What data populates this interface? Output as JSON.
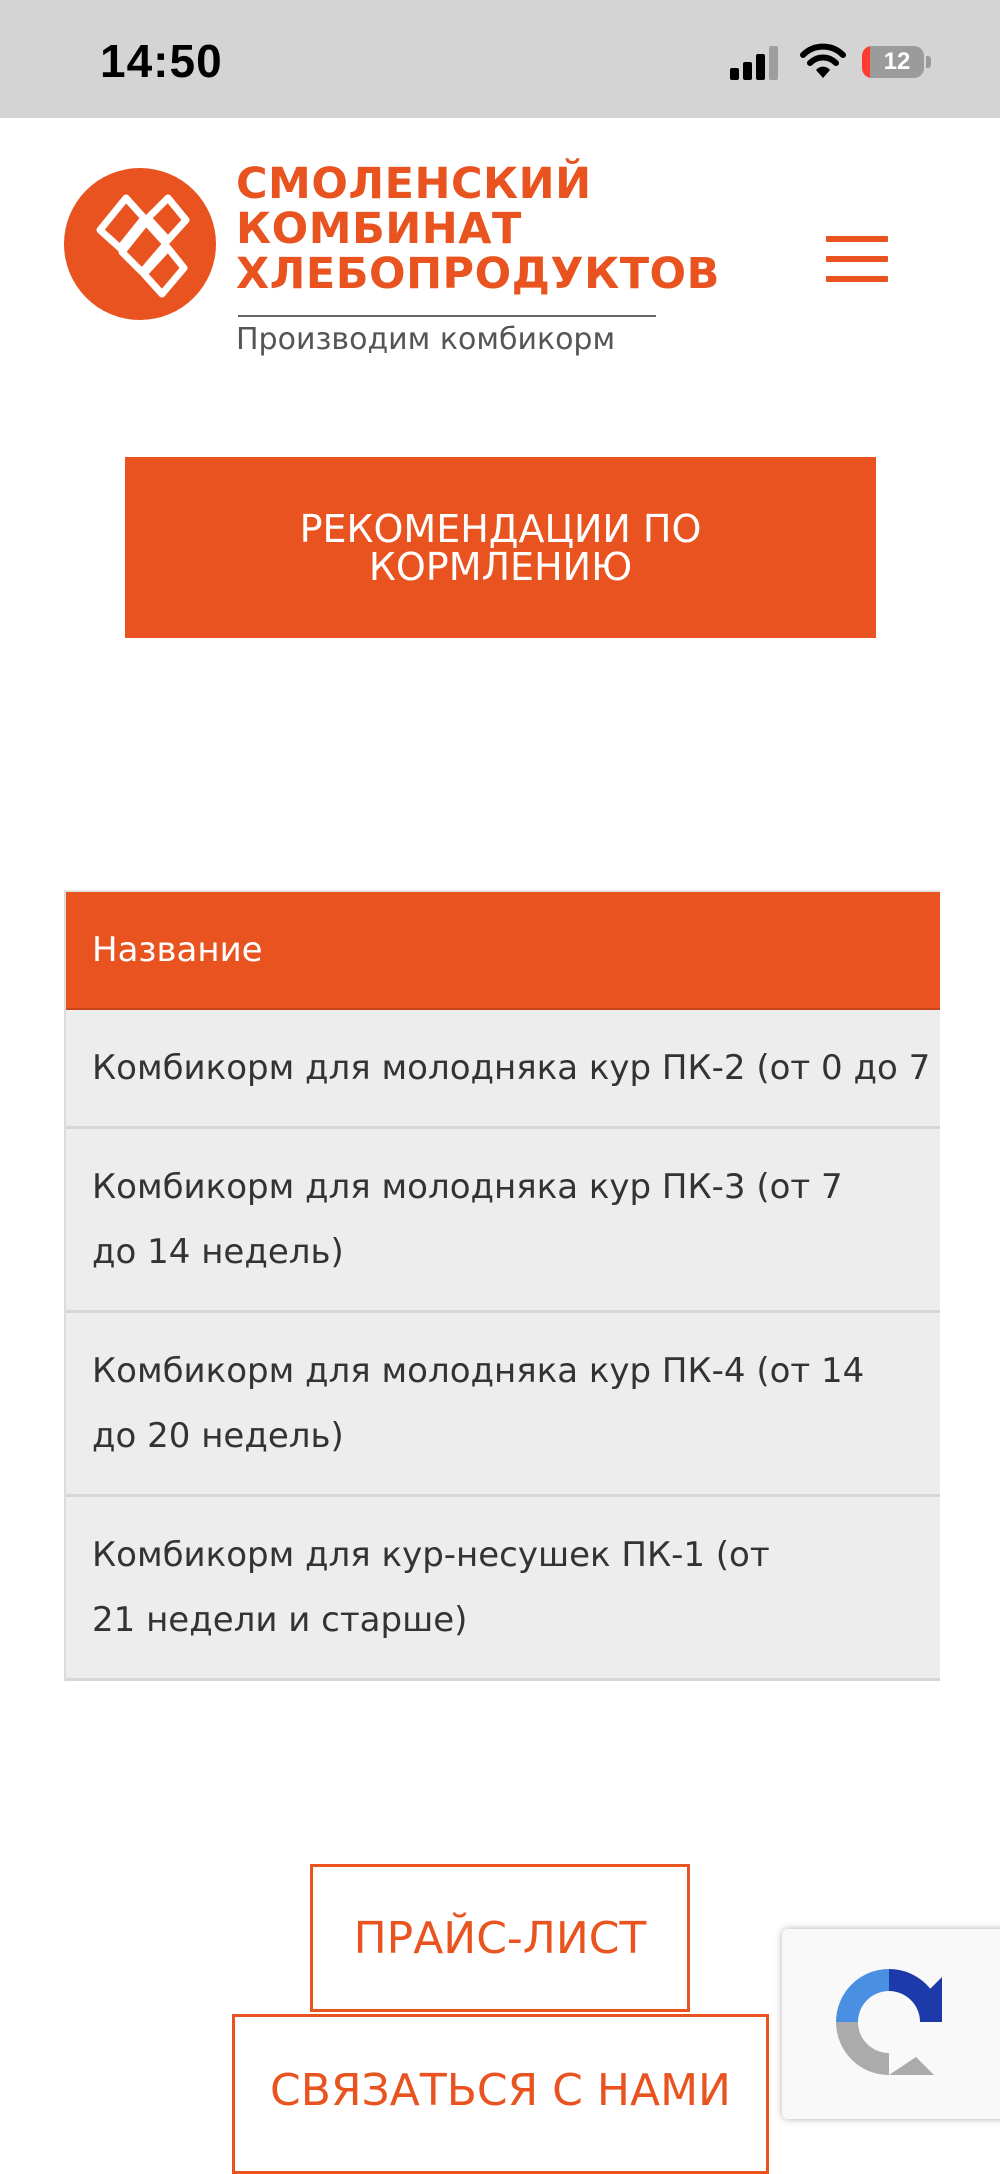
{
  "status_bar": {
    "time": "14:50",
    "battery": "12"
  },
  "header": {
    "logo_lines": [
      "СМОЛЕНСКИЙ",
      "КОМБИНАТ",
      "ХЛЕБОПРОДУКТОВ"
    ],
    "tagline": "Производим комбикорм",
    "menu_icon": "hamburger-icon"
  },
  "recommendations_button": "РЕКОМЕНДАЦИИ ПО КОРМЛЕНИЮ",
  "table": {
    "header": "Название",
    "rows": [
      "Комбикорм для молодняка кур ПК-2 (от 0 до 7",
      "Комбикорм для молодняка кур ПК-3 (от 7 до 14 недель)",
      "Комбикорм для молодняка кур ПК-4 (от 14 до 20 недель)",
      "Комбикорм для кур-несушек ПК-1 (от 21 недели и старше)"
    ]
  },
  "price_list_button": "ПРАЙС-ЛИСТ",
  "contact_button": "СВЯЗАТЬСЯ С НАМИ",
  "recaptcha_icon": "recaptcha-icon",
  "colors": {
    "accent": "#e8531f",
    "status_bar_bg": "#d4d4d4",
    "table_row_bg": "#ededed"
  }
}
